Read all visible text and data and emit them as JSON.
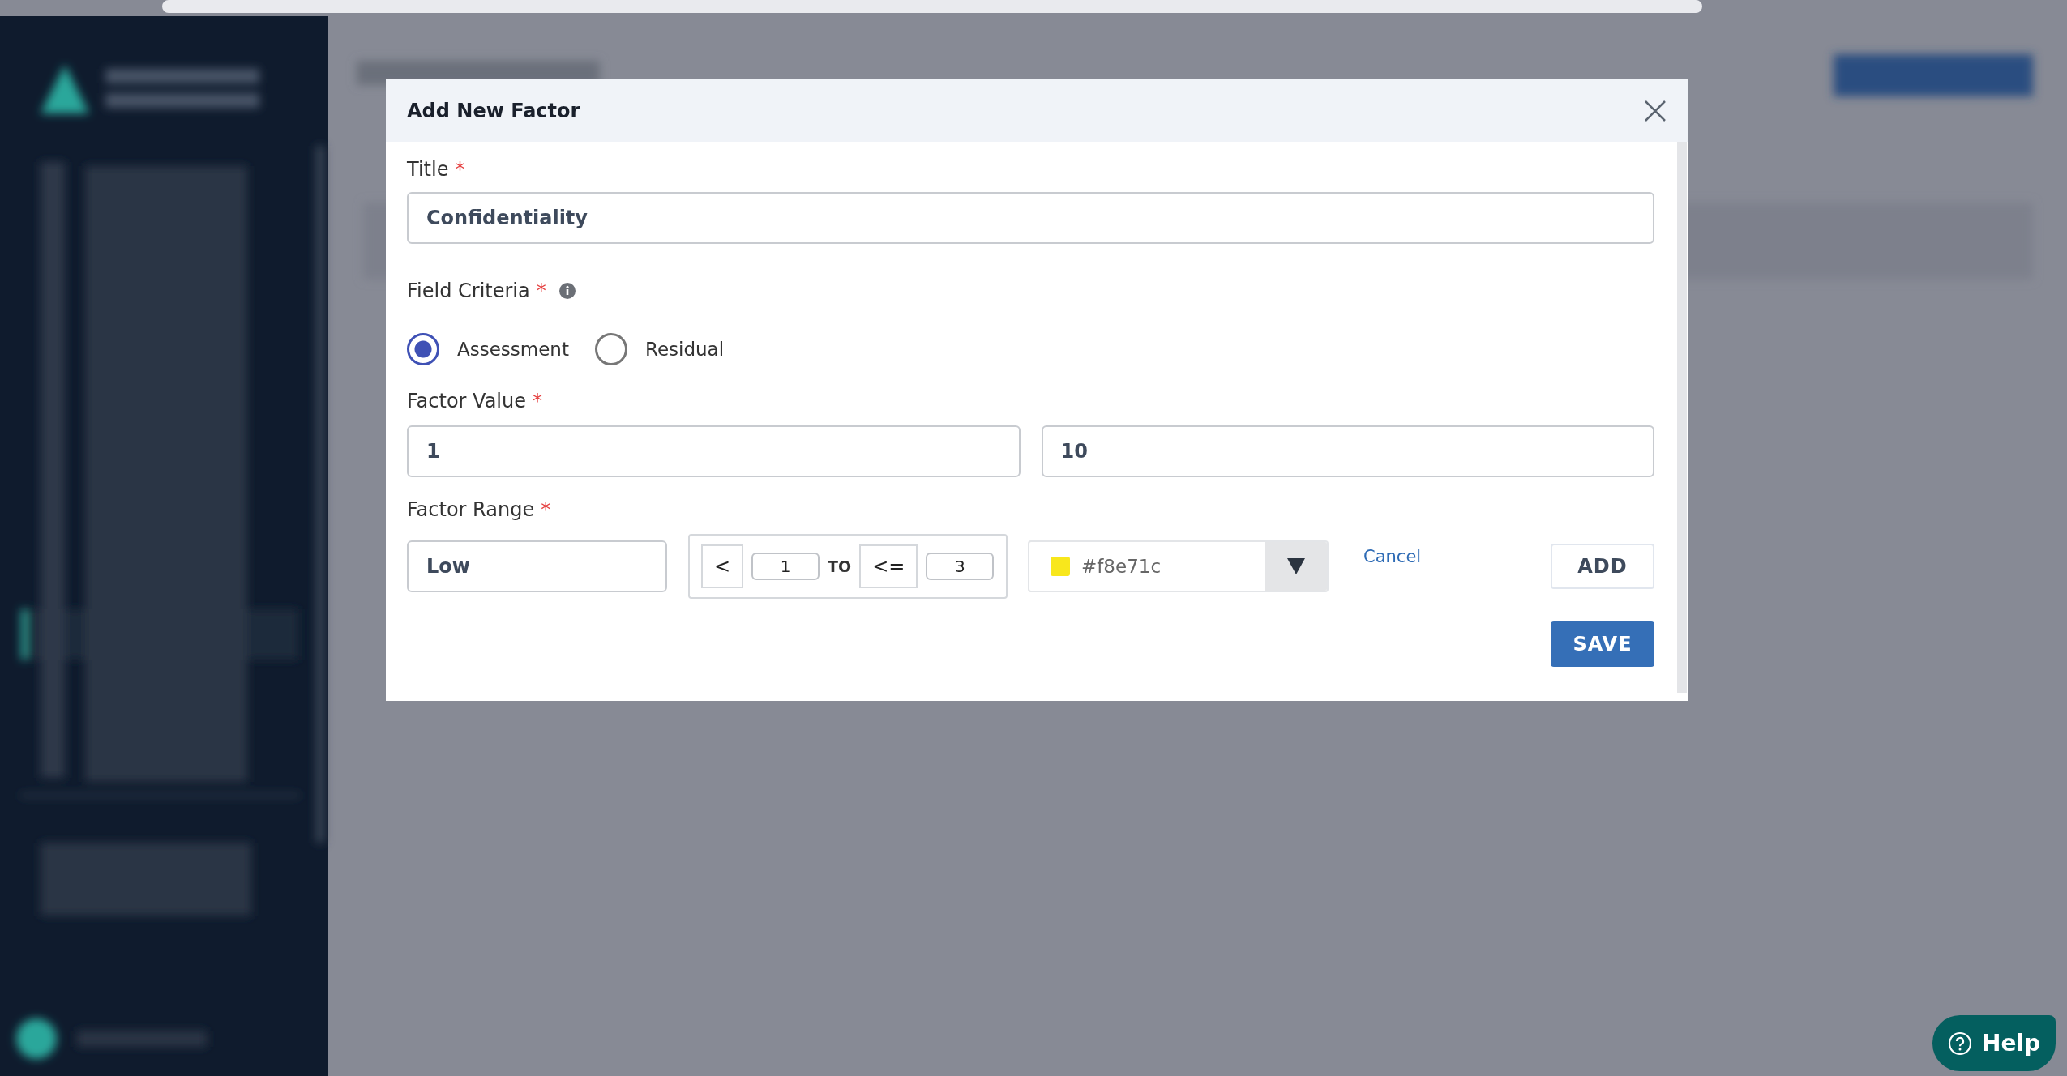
{
  "dialog": {
    "title": "Add New Factor",
    "title_field": {
      "label": "Title",
      "required": "*",
      "value": "Confidentiality"
    },
    "field_criteria": {
      "label": "Field Criteria",
      "required": "*",
      "options": [
        {
          "label": "Assessment",
          "selected": true
        },
        {
          "label": "Residual",
          "selected": false
        }
      ]
    },
    "factor_value": {
      "label": "Factor Value",
      "required": "*",
      "values": [
        "1",
        "10"
      ]
    },
    "factor_range": {
      "label": "Factor Range",
      "required": "*",
      "name": "Low",
      "lower_op": "<",
      "lower": "1",
      "to": "TO",
      "upper_op": "<=",
      "upper": "3",
      "color": {
        "value": "#f8e71c",
        "color": "#f8e71c"
      },
      "cancel": "Cancel",
      "add": "ADD"
    },
    "save": "SAVE"
  },
  "help": {
    "label": "Help"
  }
}
